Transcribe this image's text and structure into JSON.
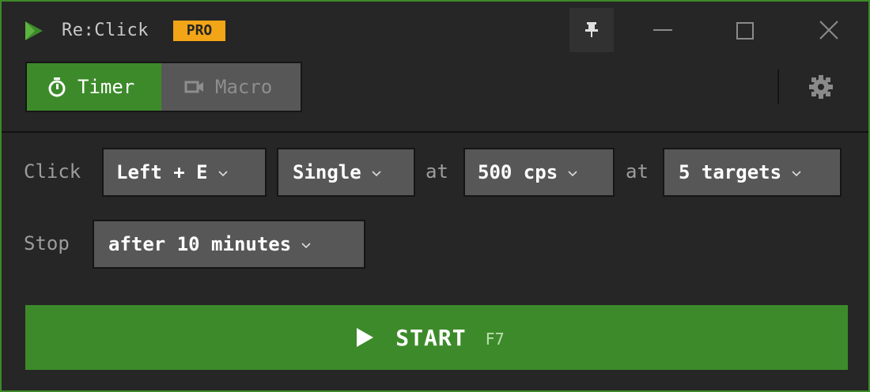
{
  "titlebar": {
    "app_title": "Re:Click",
    "badge": "PRO",
    "icons": {
      "logo": "play-triangle-logo",
      "pin": "pin-icon",
      "minimize": "minimize-icon",
      "maximize": "maximize-icon",
      "close": "close-icon"
    }
  },
  "modes": {
    "tabs": [
      {
        "label": "Timer",
        "icon": "stopwatch-icon",
        "active": true
      },
      {
        "label": "Macro",
        "icon": "video-camera-icon",
        "active": false
      }
    ],
    "settings_icon": "gear-icon"
  },
  "click_row": {
    "label": "Click",
    "button": "Left + E",
    "type": "Single",
    "at1": "at",
    "rate": "500 cps",
    "at2": "at",
    "targets": "5 targets"
  },
  "stop_row": {
    "label": "Stop",
    "condition": "after 10 minutes"
  },
  "start": {
    "label": "START",
    "hotkey": "F7"
  },
  "colors": {
    "accent": "#3d8a2a",
    "badge": "#f2a516",
    "background": "#262626",
    "control": "#575757"
  }
}
